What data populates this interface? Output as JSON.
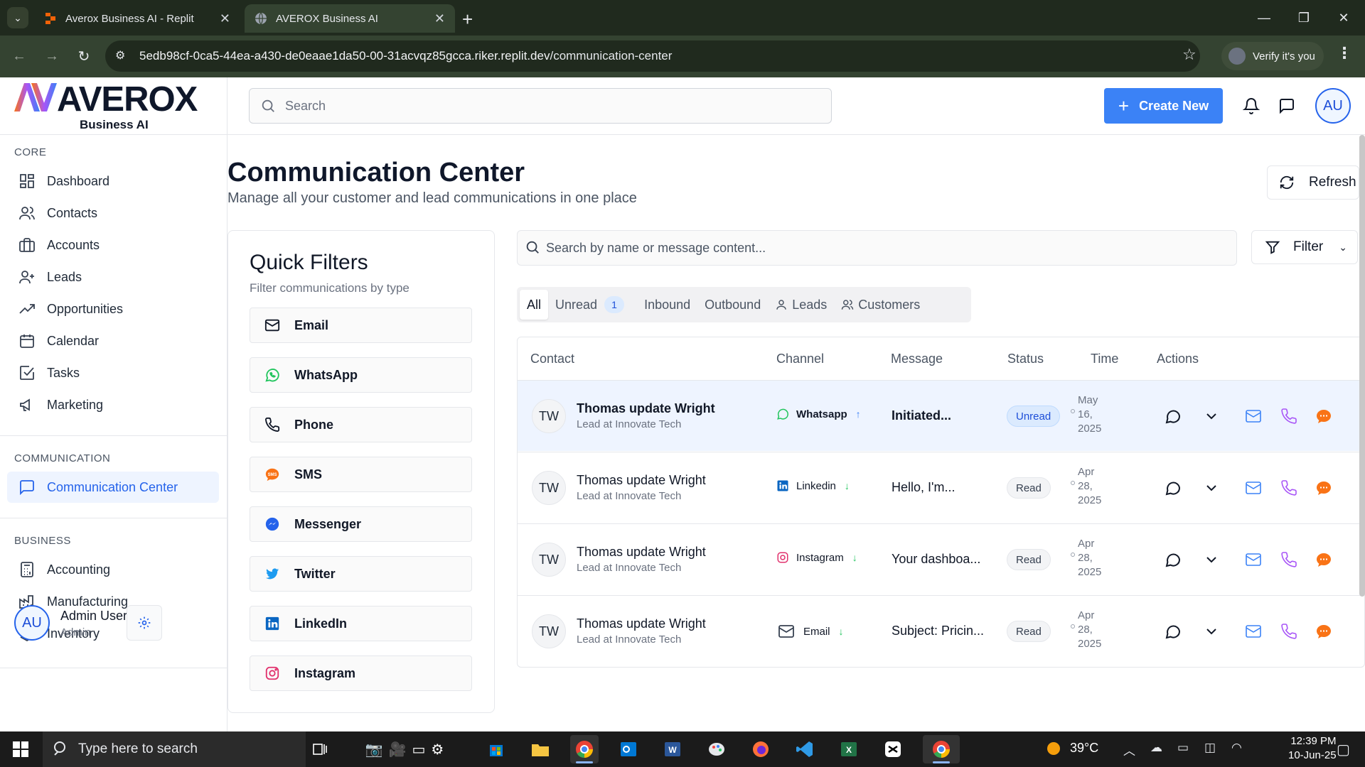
{
  "browser": {
    "tabs": [
      {
        "title": "Averox Business AI - Replit"
      },
      {
        "title": "AVEROX Business AI"
      }
    ],
    "url_host": "5edb98cf-0ca5-44ea-a430-de0eaae1da50-00-31acvqz85gcca.riker.replit.dev",
    "url_path": "/communication-center",
    "verify_label": "Verify it's you"
  },
  "brand": {
    "name": "AVEROX",
    "sub": "Business AI"
  },
  "sidebar": {
    "core_label": "CORE",
    "core_items": [
      "Dashboard",
      "Contacts",
      "Accounts",
      "Leads",
      "Opportunities",
      "Calendar",
      "Tasks",
      "Marketing"
    ],
    "communication_label": "COMMUNICATION",
    "communication_items": [
      "Communication Center"
    ],
    "business_label": "BUSINESS",
    "business_items": [
      "Accounting",
      "Manufacturing",
      "Inventory"
    ],
    "user": {
      "initials": "AU",
      "name": "Admin User",
      "role": "Admin"
    }
  },
  "header": {
    "search_placeholder": "Search",
    "create_label": "Create New",
    "avatar_initials": "AU"
  },
  "page": {
    "title": "Communication Center",
    "subtitle": "Manage all your customer and lead communications in one place",
    "refresh_label": "Refresh"
  },
  "quick_filters": {
    "title": "Quick Filters",
    "description": "Filter communications by type",
    "items": [
      "Email",
      "WhatsApp",
      "Phone",
      "SMS",
      "Messenger",
      "Twitter",
      "LinkedIn",
      "Instagram"
    ]
  },
  "messages": {
    "search_placeholder": "Search by name or message content...",
    "filter_label": "Filter",
    "tabs": [
      "All",
      "Unread",
      "Inbound",
      "Outbound",
      "Leads",
      "Customers"
    ],
    "unread_count": "1",
    "columns": [
      "Contact",
      "Channel",
      "Message",
      "Status",
      "Time",
      "Actions"
    ],
    "rows": [
      {
        "initials": "TW",
        "name": "Thomas update Wright",
        "role": "Lead at Innovate Tech",
        "channel": "Whatsapp",
        "direction": "outbound",
        "message": "Initiated...",
        "status": "Unread",
        "time_1": "May",
        "time_2": "16,",
        "time_3": "2025"
      },
      {
        "initials": "TW",
        "name": "Thomas update Wright",
        "role": "Lead at Innovate Tech",
        "channel": "Linkedin",
        "direction": "inbound",
        "message": "Hello, I'm...",
        "status": "Read",
        "time_1": "Apr",
        "time_2": "28,",
        "time_3": "2025"
      },
      {
        "initials": "TW",
        "name": "Thomas update Wright",
        "role": "Lead at Innovate Tech",
        "channel": "Instagram",
        "direction": "inbound",
        "message": "Your dashboa...",
        "status": "Read",
        "time_1": "Apr",
        "time_2": "28,",
        "time_3": "2025"
      },
      {
        "initials": "TW",
        "name": "Thomas update Wright",
        "role": "Lead at Innovate Tech",
        "channel": "Email",
        "direction": "inbound",
        "message": "Subject: Pricin...",
        "status": "Read",
        "time_1": "Apr",
        "time_2": "28,",
        "time_3": "2025"
      }
    ]
  },
  "taskbar": {
    "search_placeholder": "Type here to search",
    "temperature": "39°C",
    "time": "12:39 PM",
    "date": "10-Jun-25"
  },
  "colors": {
    "accent": "#3b82f6",
    "whatsapp": "#22c55e",
    "linkedin": "#0a66c2",
    "instagram": "#e1306c",
    "sms": "#f97316",
    "phone_action": "#a855f7"
  }
}
